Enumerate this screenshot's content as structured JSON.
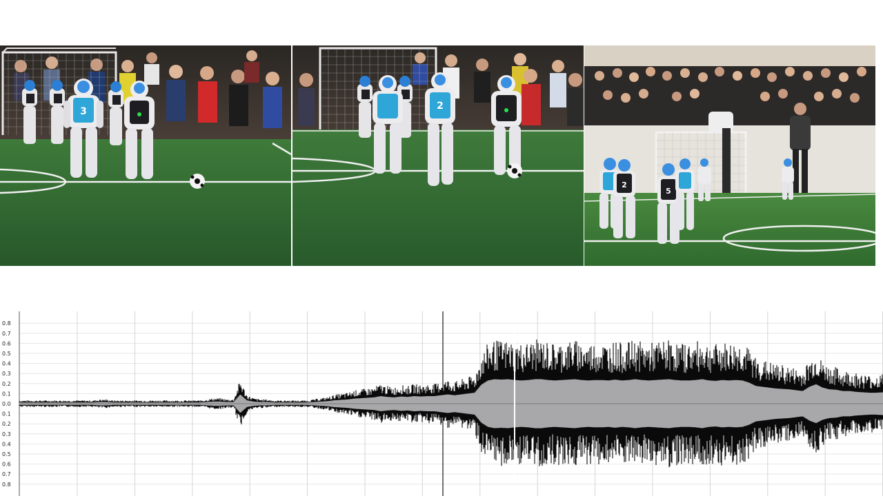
{
  "frames": [
    {
      "id": "frame-1",
      "robots": [
        {
          "number": "3"
        }
      ]
    },
    {
      "id": "frame-2",
      "robots": [
        {
          "number": "2"
        }
      ]
    },
    {
      "id": "frame-3",
      "robots": [
        {
          "number": "2"
        },
        {
          "number": "5"
        }
      ]
    }
  ],
  "waveform": {
    "ticks_top": [
      "0.8",
      "0.7",
      "0.6",
      "0.5",
      "0.4",
      "0.3",
      "0.2",
      "0.1",
      "0.0"
    ],
    "ticks_bottom": [
      "0.1",
      "0.2",
      "0.3",
      "0.4",
      "0.5",
      "0.6",
      "0.7",
      "0.8"
    ],
    "envelope": [
      0.03,
      0.03,
      0.03,
      0.03,
      0.03,
      0.03,
      0.03,
      0.03,
      0.03,
      0.03,
      0.03,
      0.03,
      0.04,
      0.04,
      0.03,
      0.03,
      0.03,
      0.03,
      0.03,
      0.03,
      0.03,
      0.03,
      0.03,
      0.03,
      0.03,
      0.03,
      0.03,
      0.03,
      0.04,
      0.05,
      0.05,
      0.04,
      0.04,
      0.22,
      0.08,
      0.05,
      0.04,
      0.04,
      0.03,
      0.03,
      0.03,
      0.03,
      0.03,
      0.03,
      0.04,
      0.05,
      0.06,
      0.08,
      0.09,
      0.1,
      0.12,
      0.13,
      0.14,
      0.15,
      0.18,
      0.16,
      0.15,
      0.17,
      0.16,
      0.18,
      0.17,
      0.18,
      0.18,
      0.2,
      0.22,
      0.2,
      0.22,
      0.24,
      0.26,
      0.45,
      0.55,
      0.58,
      0.57,
      0.58,
      0.56,
      0.55,
      0.56,
      0.58,
      0.58,
      0.56,
      0.55,
      0.56,
      0.57,
      0.58,
      0.56,
      0.55,
      0.56,
      0.56,
      0.55,
      0.57,
      0.55,
      0.56,
      0.58,
      0.56,
      0.55,
      0.56,
      0.57,
      0.58,
      0.56,
      0.55,
      0.55,
      0.56,
      0.58,
      0.55,
      0.54,
      0.56,
      0.55,
      0.56,
      0.55,
      0.5,
      0.42,
      0.4,
      0.38,
      0.36,
      0.35,
      0.34,
      0.32,
      0.3,
      0.4,
      0.46,
      0.38,
      0.34,
      0.33,
      0.3,
      0.3,
      0.28,
      0.27,
      0.26,
      0.26,
      0.27
    ]
  }
}
